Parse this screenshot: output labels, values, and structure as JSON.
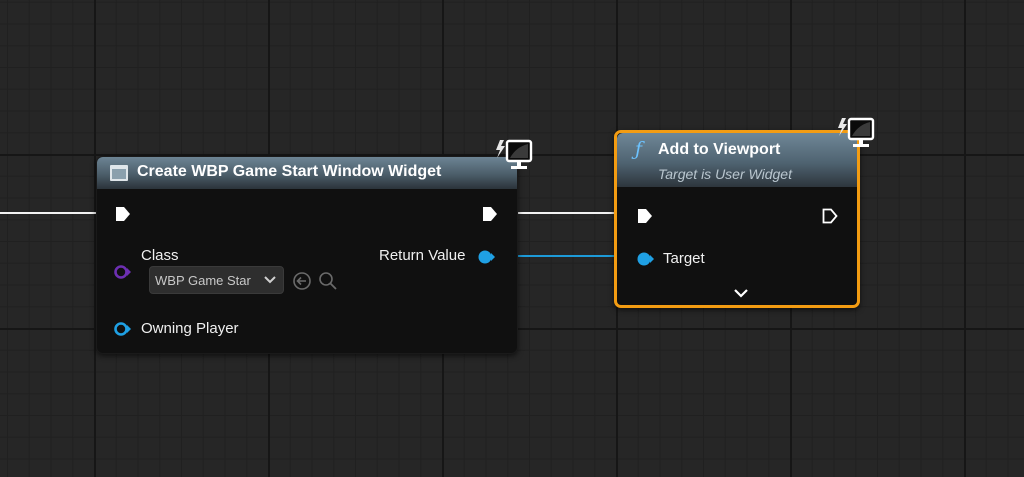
{
  "create_widget_node": {
    "title": "Create WBP Game Start Window Widget",
    "class_label": "Class",
    "class_value": "WBP Game Star",
    "return_value_label": "Return Value",
    "owning_player_label": "Owning Player"
  },
  "add_to_viewport_node": {
    "function_glyph": "ƒ",
    "title": "Add to Viewport",
    "subtitle": "Target is User Widget",
    "target_label": "Target"
  },
  "icons": {
    "corner_icon": "latent-monitor-icon",
    "class_dropdown": "chevron-down-icon",
    "use_selected": "arrow-left-circle-icon",
    "browse": "magnifier-icon",
    "node_header_icon": "widget-icon",
    "expand": "chevron-down-icon"
  },
  "colors": {
    "exec_wire": "#ffffff",
    "object_wire": "#1d9bd9",
    "object_pin": "#1fa0e4",
    "class_pin": "#6d2fb2",
    "selected_outline": "#f39c12",
    "header": "#4b5d69"
  }
}
